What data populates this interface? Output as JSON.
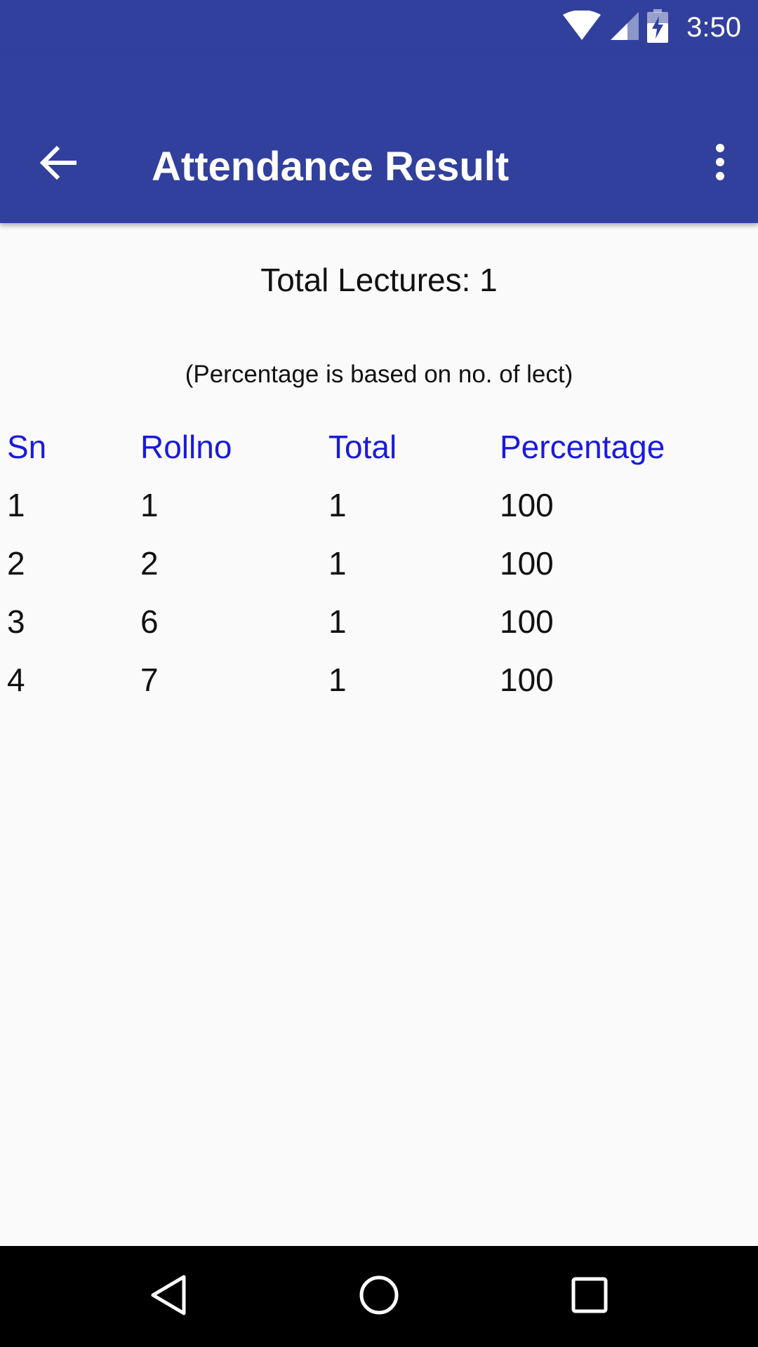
{
  "status_bar": {
    "time": "3:50",
    "icons": [
      "wifi-icon",
      "signal-icon",
      "battery-charging-icon"
    ]
  },
  "app_bar": {
    "title": "Attendance Result",
    "back_icon": "arrow-back-icon",
    "overflow_icon": "more-vert-icon",
    "color": "#31409c"
  },
  "content": {
    "total_lectures": "Total Lectures: 1",
    "note": "(Percentage is based on no. of lect)"
  },
  "table": {
    "header_color": "#1a1add",
    "columns": [
      "Sn",
      "Rollno",
      "Total",
      "Percentage"
    ],
    "rows": [
      [
        "1",
        "1",
        "1",
        "100"
      ],
      [
        "2",
        "2",
        "1",
        "100"
      ],
      [
        "3",
        "6",
        "1",
        "100"
      ],
      [
        "4",
        "7",
        "1",
        "100"
      ]
    ]
  },
  "nav_bar": {
    "icons": [
      "back-triangle-icon",
      "home-circle-icon",
      "recents-square-icon"
    ]
  }
}
